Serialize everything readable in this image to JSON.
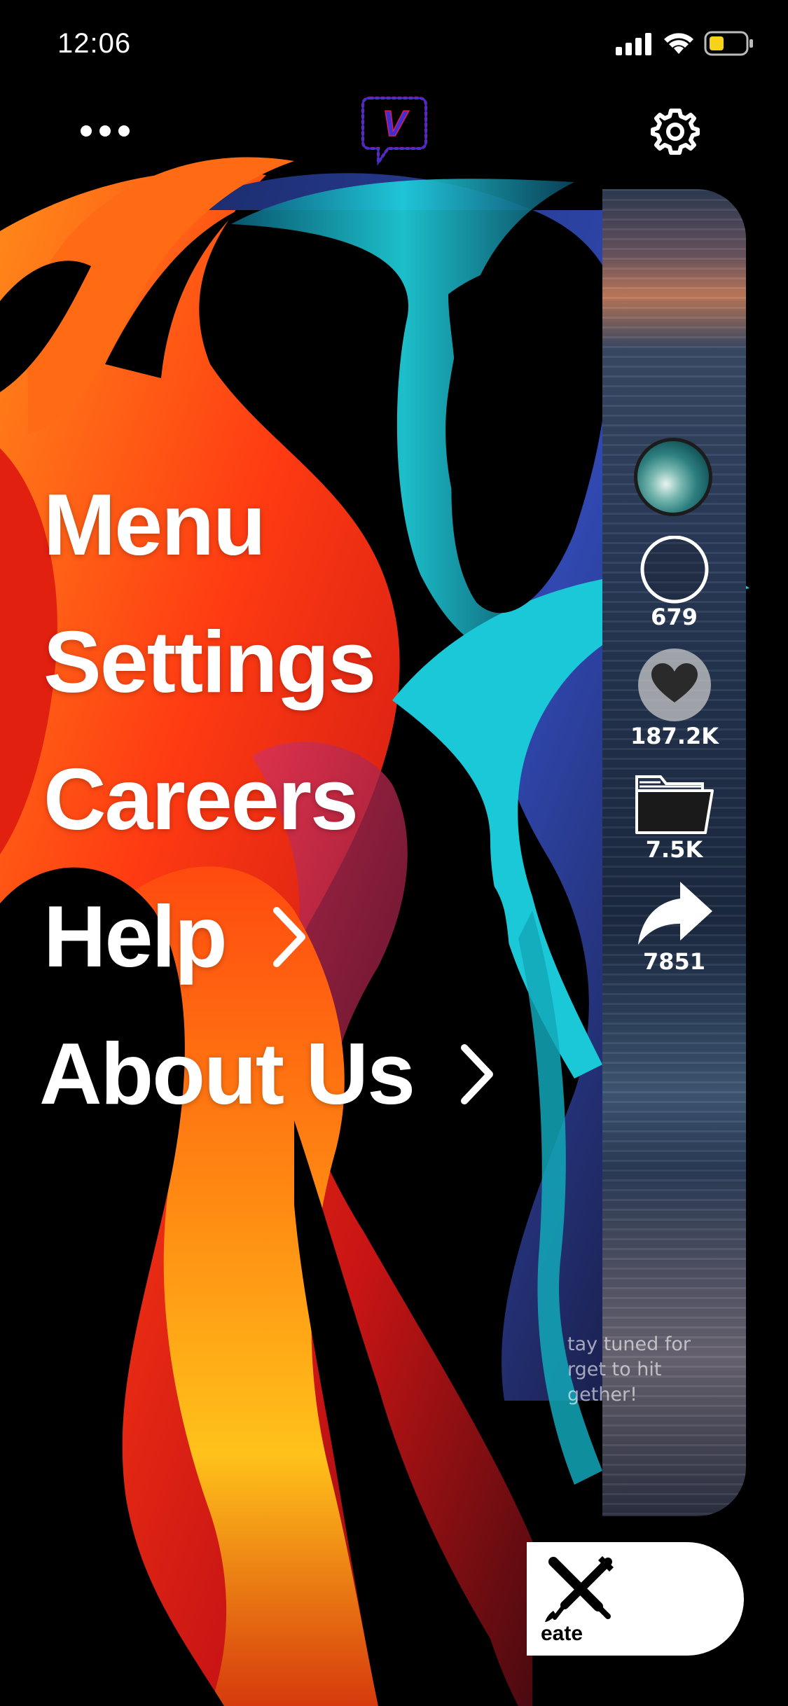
{
  "status_bar": {
    "time": "12:06"
  },
  "header": {
    "logo_letter": "V"
  },
  "menu": {
    "items": [
      {
        "label": "Menu",
        "has_chevron": false
      },
      {
        "label": "Settings",
        "has_chevron": false
      },
      {
        "label": "Careers",
        "has_chevron": false
      },
      {
        "label": "Help",
        "has_chevron": true
      },
      {
        "label": "About Us",
        "has_chevron": true
      }
    ]
  },
  "rail": {
    "comments_count": "679",
    "likes_count": "187.2K",
    "saves_count": "7.5K",
    "shares_count": "7851"
  },
  "post": {
    "caption_visible": "tay tuned for\nrget to hit\ngether!"
  },
  "create": {
    "label": "eate"
  },
  "colors": {
    "background": "#000000",
    "text": "#ffffff",
    "battery_level": "#f7d21a",
    "logo_outline": "#3b2fd6",
    "logo_glow": "#e21a5a"
  },
  "icons": [
    "more-dots-icon",
    "logo-icon",
    "gear-icon",
    "chevron-right-icon",
    "comment-bubble-icon",
    "heart-icon",
    "folder-icon",
    "share-arrow-icon",
    "pen-brush-cross-icon"
  ]
}
